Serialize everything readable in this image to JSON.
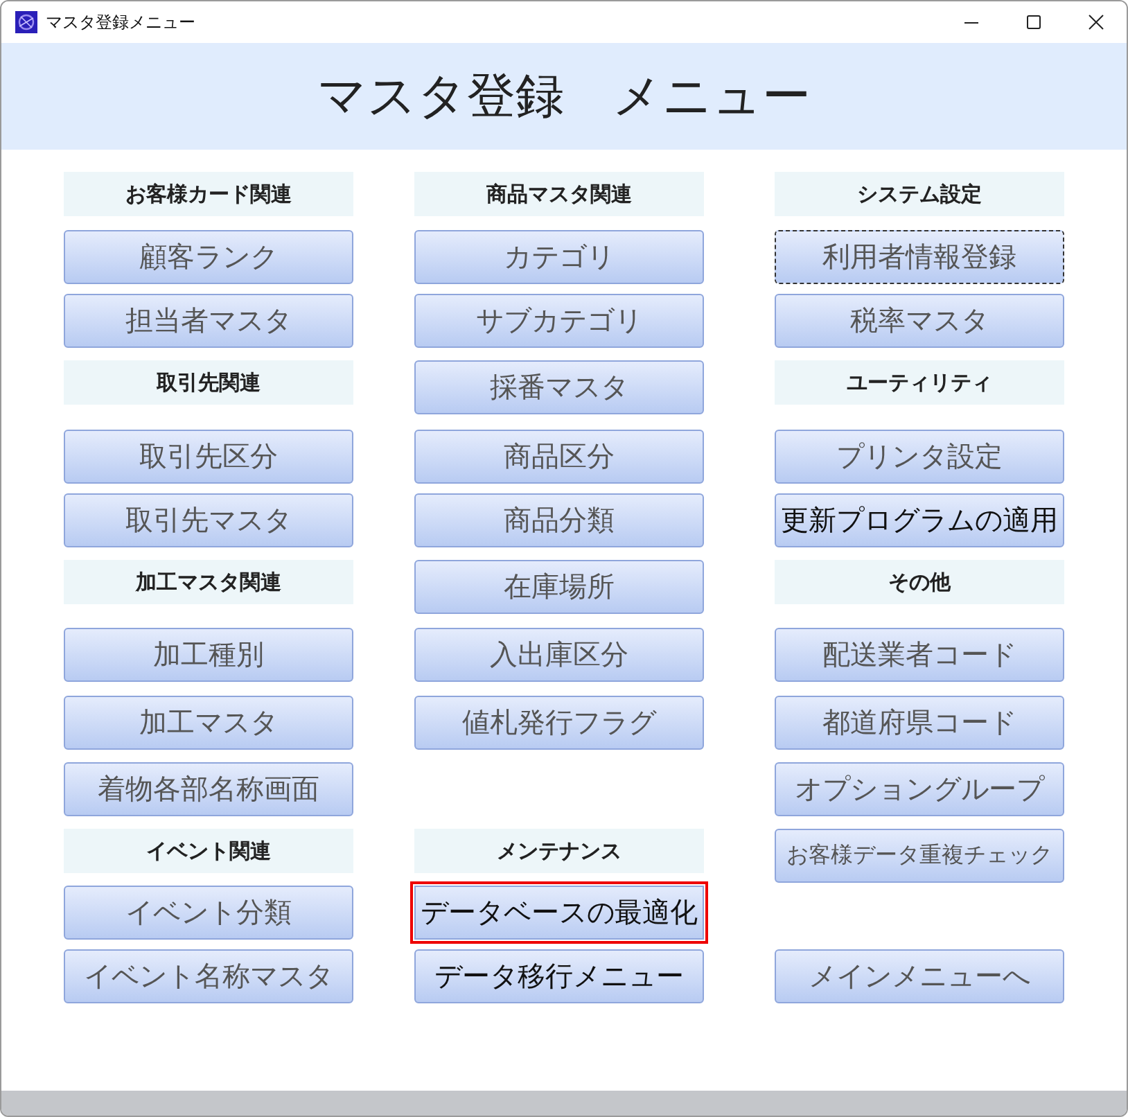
{
  "window": {
    "title": "マスタ登録メニュー"
  },
  "heading": "マスタ登録　メニュー",
  "columns": [
    {
      "cells": [
        {
          "kind": "header",
          "label": "お客様カード関連"
        },
        {
          "kind": "button",
          "label": "顧客ランク",
          "dark_text": false,
          "focused": false,
          "outlined": false
        },
        {
          "kind": "button",
          "label": "担当者マスタ",
          "dark_text": false,
          "focused": false,
          "outlined": false
        },
        {
          "kind": "header",
          "label": "取引先関連"
        },
        {
          "kind": "button",
          "label": "取引先区分",
          "dark_text": false,
          "focused": false,
          "outlined": false
        },
        {
          "kind": "button",
          "label": "取引先マスタ",
          "dark_text": false,
          "focused": false,
          "outlined": false
        },
        {
          "kind": "header",
          "label": "加工マスタ関連"
        },
        {
          "kind": "button",
          "label": "加工種別",
          "dark_text": false,
          "focused": false,
          "outlined": false
        },
        {
          "kind": "button",
          "label": "加工マスタ",
          "dark_text": false,
          "focused": false,
          "outlined": false
        },
        {
          "kind": "button",
          "label": "着物各部名称画面",
          "dark_text": false,
          "focused": false,
          "outlined": false
        },
        {
          "kind": "header",
          "label": "イベント関連"
        },
        {
          "kind": "button",
          "label": "イベント分類",
          "dark_text": false,
          "focused": false,
          "outlined": false
        },
        {
          "kind": "button",
          "label": "イベント名称マスタ",
          "dark_text": false,
          "focused": false,
          "outlined": false
        }
      ]
    },
    {
      "cells": [
        {
          "kind": "header",
          "label": "商品マスタ関連"
        },
        {
          "kind": "button",
          "label": "カテゴリ",
          "dark_text": false,
          "focused": false,
          "outlined": false
        },
        {
          "kind": "button",
          "label": "サブカテゴリ",
          "dark_text": false,
          "focused": false,
          "outlined": false
        },
        {
          "kind": "button",
          "label": "採番マスタ",
          "dark_text": false,
          "focused": false,
          "outlined": false
        },
        {
          "kind": "button",
          "label": "商品区分",
          "dark_text": false,
          "focused": false,
          "outlined": false
        },
        {
          "kind": "button",
          "label": "商品分類",
          "dark_text": false,
          "focused": false,
          "outlined": false
        },
        {
          "kind": "button",
          "label": "在庫場所",
          "dark_text": false,
          "focused": false,
          "outlined": false
        },
        {
          "kind": "button",
          "label": "入出庫区分",
          "dark_text": false,
          "focused": false,
          "outlined": false
        },
        {
          "kind": "button",
          "label": "値札発行フラグ",
          "dark_text": false,
          "focused": false,
          "outlined": false
        },
        null,
        {
          "kind": "header",
          "label": "メンテナンス"
        },
        {
          "kind": "button",
          "label": "データベースの最適化",
          "dark_text": true,
          "focused": false,
          "outlined": true
        },
        {
          "kind": "button",
          "label": "データ移行メニュー",
          "dark_text": true,
          "focused": false,
          "outlined": false
        }
      ]
    },
    {
      "cells": [
        {
          "kind": "header",
          "label": "システム設定"
        },
        {
          "kind": "button",
          "label": "利用者情報登録",
          "dark_text": false,
          "focused": true,
          "outlined": false
        },
        {
          "kind": "button",
          "label": "税率マスタ",
          "dark_text": false,
          "focused": false,
          "outlined": false
        },
        {
          "kind": "header",
          "label": "ユーティリティ"
        },
        {
          "kind": "button",
          "label": "プリンタ設定",
          "dark_text": false,
          "focused": false,
          "outlined": false
        },
        {
          "kind": "button",
          "label": "更新プログラムの適用",
          "dark_text": true,
          "focused": false,
          "outlined": false
        },
        {
          "kind": "header",
          "label": "その他"
        },
        {
          "kind": "button",
          "label": "配送業者コード",
          "dark_text": false,
          "focused": false,
          "outlined": false
        },
        {
          "kind": "button",
          "label": "都道府県コード",
          "dark_text": false,
          "focused": false,
          "outlined": false
        },
        {
          "kind": "button",
          "label": "オプショングループ",
          "dark_text": false,
          "focused": false,
          "outlined": false
        },
        {
          "kind": "button",
          "label": "お客様データ重複チェック",
          "dark_text": false,
          "focused": false,
          "outlined": false
        },
        null,
        {
          "kind": "button",
          "label": "メインメニューへ",
          "dark_text": false,
          "focused": false,
          "outlined": false
        }
      ]
    }
  ]
}
